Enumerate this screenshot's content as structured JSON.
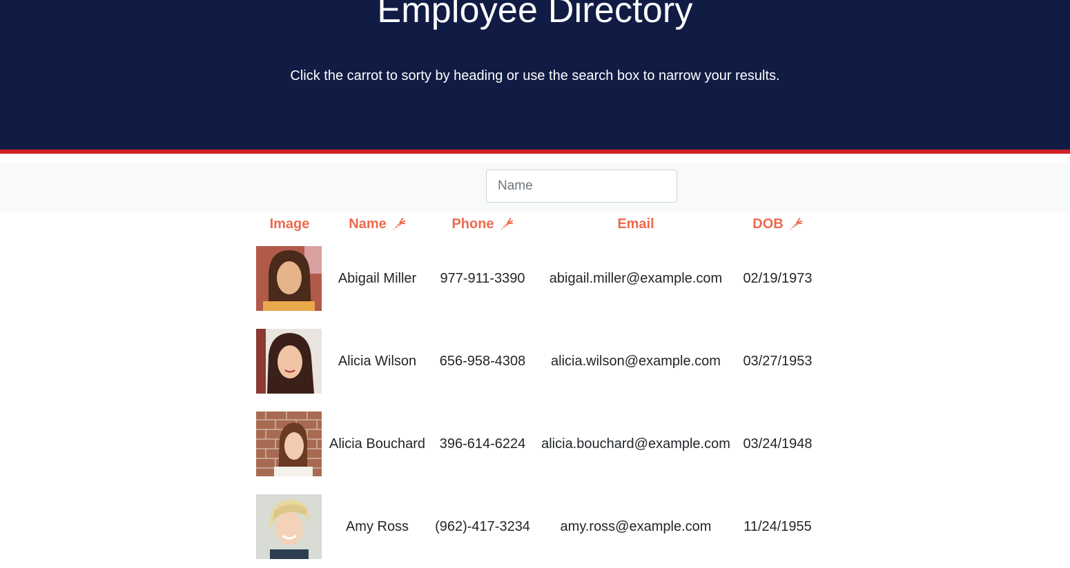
{
  "header": {
    "title": "Employee Directory",
    "subtitle": "Click the carrot to sorty by heading or use the search box to narrow your results."
  },
  "search": {
    "placeholder": "Name",
    "value": ""
  },
  "table": {
    "headers": {
      "image": "Image",
      "name": "Name",
      "phone": "Phone",
      "email": "Email",
      "dob": "DOB"
    },
    "sort_icon": "carrot-icon",
    "rows": [
      {
        "name": "Abigail Miller",
        "phone": "977-911-3390",
        "email": "abigail.miller@example.com",
        "dob": "02/19/1973"
      },
      {
        "name": "Alicia Wilson",
        "phone": "656-958-4308",
        "email": "alicia.wilson@example.com",
        "dob": "03/27/1953"
      },
      {
        "name": "Alicia Bouchard",
        "phone": "396-614-6224",
        "email": "alicia.bouchard@example.com",
        "dob": "03/24/1948"
      },
      {
        "name": "Amy Ross",
        "phone": "(962)-417-3234",
        "email": "amy.ross@example.com",
        "dob": "11/24/1955"
      }
    ]
  },
  "colors": {
    "header_bg": "#101c44",
    "accent_stripe": "#d32226",
    "heading_text": "#ec6a4e"
  }
}
